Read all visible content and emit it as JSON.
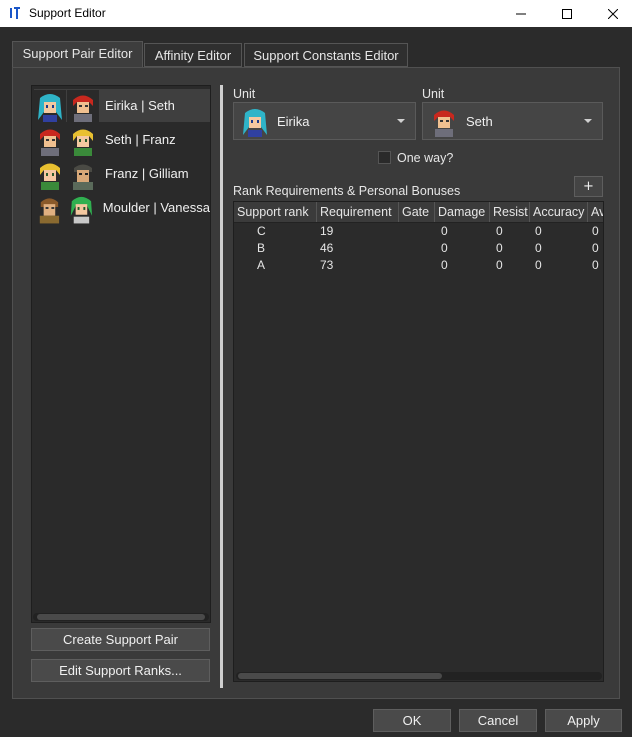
{
  "window": {
    "title": "Support Editor",
    "controls": [
      "minimize-icon",
      "maximize-icon",
      "close-icon"
    ]
  },
  "tabs": [
    {
      "label": "Support Pair Editor",
      "active": true
    },
    {
      "label": "Affinity Editor",
      "active": false
    },
    {
      "label": "Support Constants Editor",
      "active": false
    }
  ],
  "pairs": [
    {
      "label": "Eirika | Seth",
      "selected": true
    },
    {
      "label": "Seth | Franz",
      "selected": false
    },
    {
      "label": "Franz | Gilliam",
      "selected": false
    },
    {
      "label": "Moulder | Vanessa",
      "selected": false
    }
  ],
  "left_buttons": {
    "create": "Create Support Pair",
    "edit": "Edit Support Ranks..."
  },
  "unit1": {
    "label": "Unit",
    "value": "Eirika"
  },
  "unit2": {
    "label": "Unit",
    "value": "Seth"
  },
  "one_way": {
    "label": "One way?",
    "checked": false
  },
  "ranks": {
    "title": "Rank Requirements & Personal Bonuses",
    "add_label": "+",
    "columns": [
      "Support rank",
      "Requirement",
      "Gate",
      "Damage",
      "Resist",
      "Accuracy",
      "Av"
    ],
    "rows": [
      [
        "C",
        "19",
        "",
        "0",
        "0",
        "0",
        "0"
      ],
      [
        "B",
        "46",
        "",
        "0",
        "0",
        "0",
        "0"
      ],
      [
        "A",
        "73",
        "",
        "0",
        "0",
        "0",
        "0"
      ]
    ]
  },
  "footer": {
    "ok": "OK",
    "cancel": "Cancel",
    "apply": "Apply"
  },
  "colors": {
    "background": "#2b2b2b",
    "panel": "#3a3a3a",
    "accent_blue": "#1a56c8"
  }
}
